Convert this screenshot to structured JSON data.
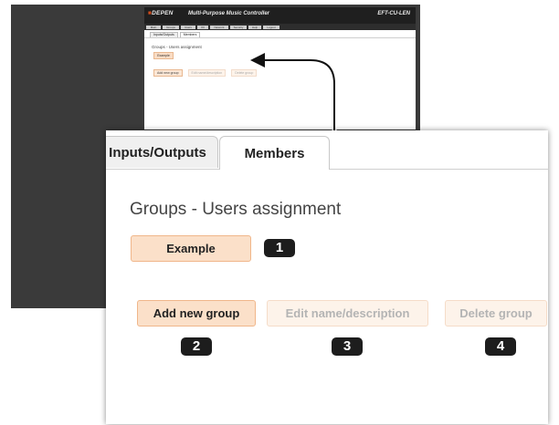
{
  "thumbnail": {
    "logo": "DEPEN",
    "title": "Multi-Purpose Music Controller",
    "model": "EFT-CU-LEN",
    "nav_items": [
      "Main",
      "Groups",
      "Users",
      "I/O",
      "Network",
      "Security",
      "Help",
      "Logout"
    ],
    "subtabs": [
      "Inputs/Outputs",
      "Members"
    ],
    "heading": "Groups - Users assignment",
    "example_label": "Example",
    "buttons": [
      "Add new group",
      "Edit name/description",
      "Delete group"
    ]
  },
  "panel": {
    "tabs": {
      "inputs_outputs": "Inputs/Outputs",
      "members": "Members"
    },
    "heading": "Groups - Users assignment",
    "example_button": "Example",
    "add_group_button": "Add new group",
    "edit_button": "Edit name/description",
    "delete_button": "Delete group",
    "badges": {
      "example": "1",
      "add": "2",
      "edit": "3",
      "delete": "4"
    }
  },
  "colors": {
    "backdrop": "#3a3a3a",
    "button_active_bg": "#fbe0c9",
    "button_active_border": "#f0b68a",
    "button_disabled_bg": "#fdf3ea",
    "badge_bg": "#1d1d1d"
  }
}
